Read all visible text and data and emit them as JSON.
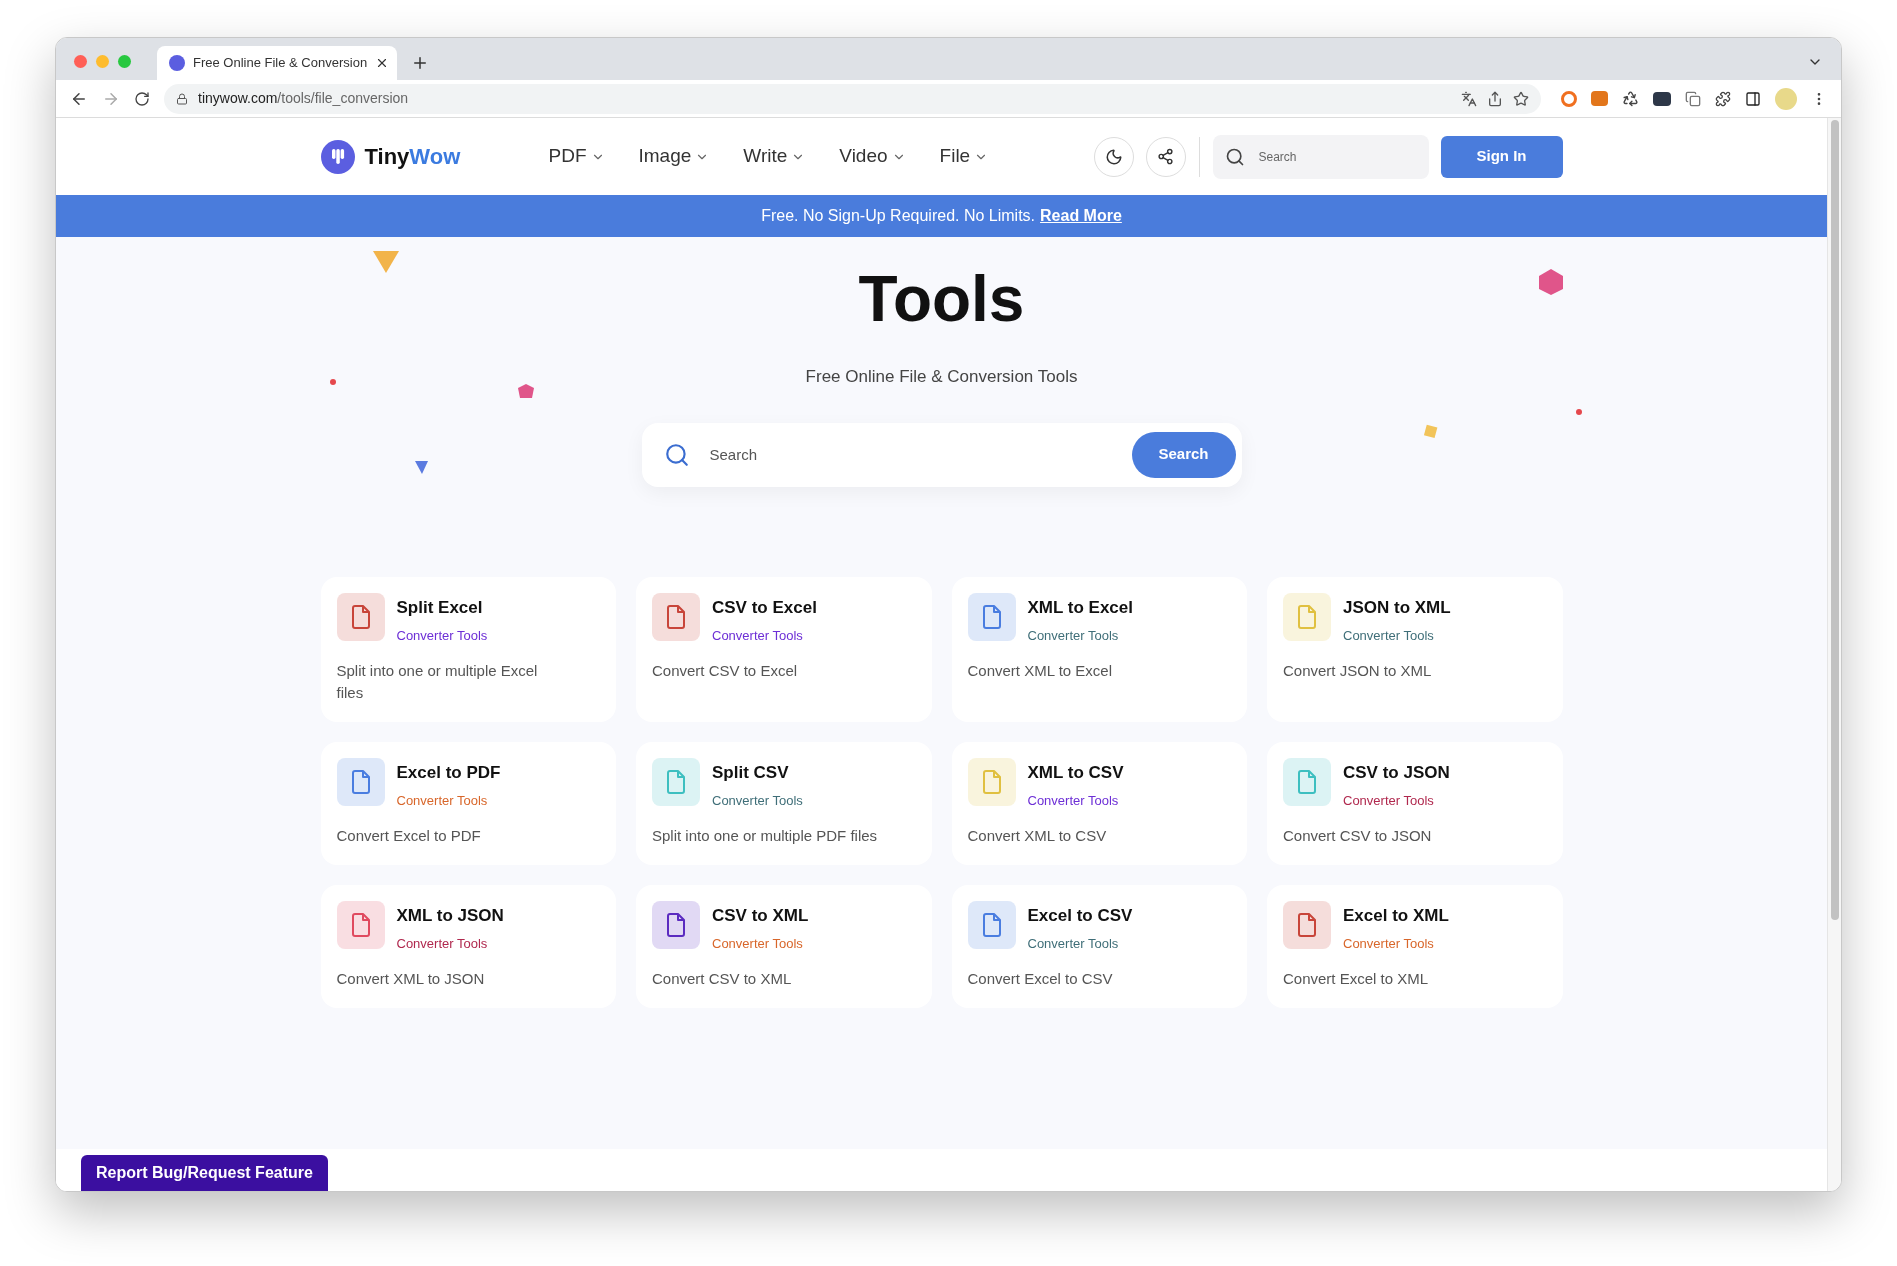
{
  "browser": {
    "tab_title": "Free Online File & Conversion",
    "url_host": "tinywow.com",
    "url_path": "/tools/file_conversion"
  },
  "header": {
    "logo_first": "Tiny",
    "logo_second": "Wow",
    "nav": [
      "PDF",
      "Image",
      "Write",
      "Video",
      "File"
    ],
    "search_placeholder": "Search",
    "sign_in": "Sign In"
  },
  "banner": {
    "text": "Free. No Sign-Up Required. No Limits.",
    "link": "Read More"
  },
  "hero": {
    "title": "Tools",
    "subtitle": "Free Online File & Conversion Tools",
    "search_placeholder": "Search",
    "search_button": "Search"
  },
  "tools": [
    {
      "title": "Split Excel",
      "category": {
        "label": "Converter Tools",
        "color": "#6d2fd6"
      },
      "description": "Split into one or multiple Excel files",
      "color": "#c8453a"
    },
    {
      "title": "CSV to Excel",
      "category": {
        "label": "Converter Tools",
        "color": "#6d2fd6"
      },
      "description": "Convert CSV to Excel",
      "color": "#c8453a"
    },
    {
      "title": "XML to Excel",
      "category": {
        "label": "Converter Tools",
        "color": "#3f6e78"
      },
      "description": "Convert XML to Excel",
      "color": "#4a7de0"
    },
    {
      "title": "JSON to XML",
      "category": {
        "label": "Converter Tools",
        "color": "#3f6e78"
      },
      "description": "Convert JSON to XML",
      "color": "#e0c040"
    },
    {
      "title": "Excel to PDF",
      "category": {
        "label": "Converter Tools",
        "color": "#d8662a"
      },
      "description": "Convert Excel to PDF",
      "color": "#4a7de0"
    },
    {
      "title": "Split CSV",
      "category": {
        "label": "Converter Tools",
        "color": "#3f6e78"
      },
      "description": "Split into one or multiple PDF files",
      "color": "#3dbfc0"
    },
    {
      "title": "XML to CSV",
      "category": {
        "label": "Converter Tools",
        "color": "#6d2fd6"
      },
      "description": "Convert XML to CSV",
      "color": "#e0c040"
    },
    {
      "title": "CSV to JSON",
      "category": {
        "label": "Converter Tools",
        "color": "#b0284e"
      },
      "description": "Convert CSV to JSON",
      "color": "#3dbfc0"
    },
    {
      "title": "XML to JSON",
      "category": {
        "label": "Converter Tools",
        "color": "#b0284e"
      },
      "description": "Convert XML to JSON",
      "color": "#e04a5f"
    },
    {
      "title": "CSV to XML",
      "category": {
        "label": "Converter Tools",
        "color": "#d8662a"
      },
      "description": "Convert CSV to XML",
      "color": "#5b2bc0"
    },
    {
      "title": "Excel to CSV",
      "category": {
        "label": "Converter Tools",
        "color": "#3f6e78"
      },
      "description": "Convert Excel to CSV",
      "color": "#4a7de0"
    },
    {
      "title": "Excel to XML",
      "category": {
        "label": "Converter Tools",
        "color": "#d8662a"
      },
      "description": "Convert Excel to XML",
      "color": "#c8453a"
    }
  ],
  "report_button": "Report Bug/Request Feature"
}
